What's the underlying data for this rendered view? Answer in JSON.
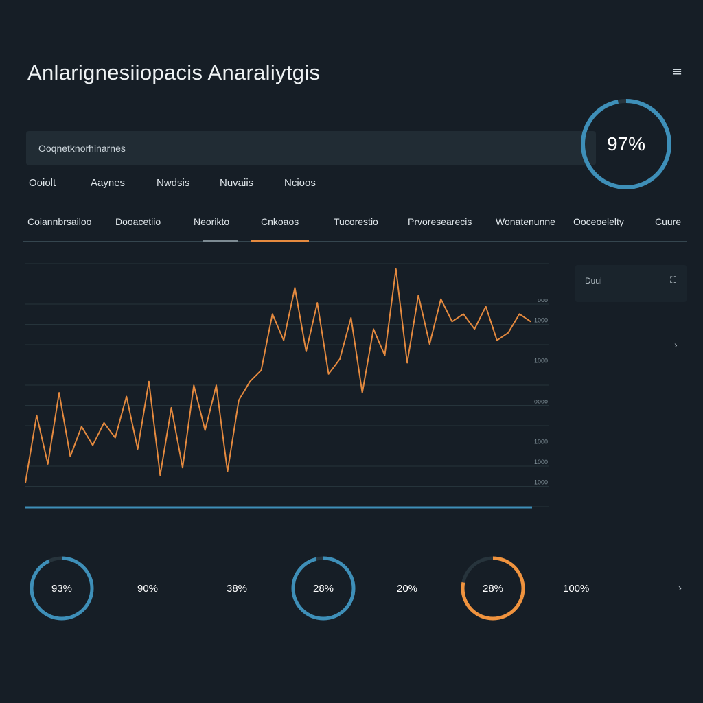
{
  "header": {
    "title": "Anlarignesiiopacis Anaraliytgis",
    "menu_icon": "menu-icon",
    "menu_glyph": "≡"
  },
  "search": {
    "value": "Ooqnetknorhinarnes"
  },
  "top_gauge": {
    "label": "97%",
    "percent": 97,
    "color": "#3e8fb8"
  },
  "filters": [
    {
      "label": "Ooiolt"
    },
    {
      "label": "Aaynes"
    },
    {
      "label": "Nwdsis"
    },
    {
      "label": "Nuvaiis"
    },
    {
      "label": "Ncioos"
    }
  ],
  "tabs": [
    {
      "label": "Coiannbrsailoo"
    },
    {
      "label": "Dooacetiio"
    },
    {
      "label": "Neorikto"
    },
    {
      "label": "Cnkoaos",
      "active": true
    },
    {
      "label": "Tucorestio"
    },
    {
      "label": "Prvoresearecis"
    },
    {
      "label": "Wonatenunne"
    },
    {
      "label": "Ooceoelelty"
    },
    {
      "label": "Cuure"
    }
  ],
  "legend": {
    "label": "Duui",
    "icon": "expand-icon",
    "glyph": "⛶",
    "chevron": "›"
  },
  "chart_data": {
    "type": "line",
    "series": [
      {
        "color": "#e58a3f",
        "x": [
          0,
          1,
          2,
          3,
          4,
          5,
          6,
          7,
          8,
          9,
          10,
          11,
          12,
          13,
          14,
          15,
          16,
          17,
          18,
          19,
          20,
          21,
          22,
          23,
          24,
          25,
          26,
          27,
          28,
          29,
          30,
          31,
          32,
          33,
          34,
          35,
          36,
          37,
          38,
          39,
          40,
          41,
          42,
          43,
          44,
          45
        ],
        "values": [
          4,
          22,
          9,
          28,
          11,
          19,
          14,
          20,
          16,
          27,
          13,
          31,
          6,
          24,
          8,
          30,
          18,
          30,
          7,
          26,
          31,
          34,
          49,
          42,
          56,
          39,
          52,
          33,
          37,
          48,
          28,
          45,
          38,
          61,
          36,
          54,
          41,
          53,
          47,
          49,
          45,
          51,
          42,
          44,
          49,
          47
        ]
      }
    ],
    "ytick_labels": [
      "ooo",
      "1000",
      "1000",
      "oooo",
      "1000",
      "1000",
      "1000"
    ],
    "ylim": [
      0,
      100
    ],
    "grid": true,
    "baseline_color": "#3e8fb8"
  },
  "bottom_stats": {
    "gauges": [
      {
        "label": "93%",
        "percent": 93,
        "color": "#3e8fb8"
      },
      {
        "label": "28%",
        "percent": 96,
        "color": "#3e8fb8"
      },
      {
        "label": "28%",
        "percent": 78,
        "color": "#f0933e"
      }
    ],
    "texts": [
      "90%",
      "38%",
      "20%",
      "100%"
    ],
    "chevron": "›"
  }
}
